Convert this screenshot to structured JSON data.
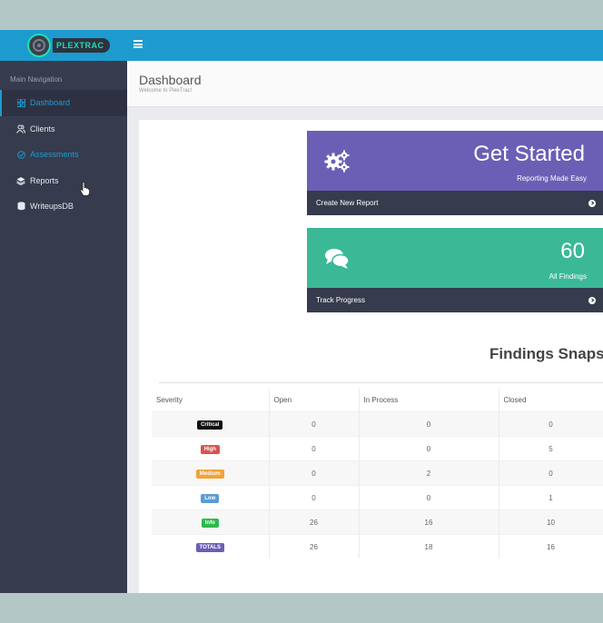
{
  "app": {
    "logo_text": "PLEXTRAC"
  },
  "sidebar": {
    "title": "Main Navigation",
    "items": [
      {
        "label": "Dashboard",
        "icon": "grid-icon"
      },
      {
        "label": "Clients",
        "icon": "users-icon"
      },
      {
        "label": "Assessments",
        "icon": "check-circle-icon"
      },
      {
        "label": "Reports",
        "icon": "layers-icon"
      },
      {
        "label": "WriteupsDB",
        "icon": "database-icon"
      }
    ]
  },
  "header": {
    "title": "Dashboard",
    "subtitle": "Welcome to PlexTrac!"
  },
  "cards": {
    "get_started": {
      "title": "Get Started",
      "subtitle": "Reporting Made Easy",
      "action": "Create New Report",
      "color": "#6b5fb5"
    },
    "findings": {
      "count": "60",
      "subtitle": "All Findings",
      "action": "Track Progress",
      "color": "#3bb996"
    }
  },
  "snapshot": {
    "title": "Findings Snapsh",
    "columns": [
      "Severity",
      "Open",
      "In Process",
      "Closed"
    ],
    "rows": [
      {
        "severity": "Critical",
        "color": "#111111",
        "open": "0",
        "in_process": "0",
        "closed": "0"
      },
      {
        "severity": "High",
        "color": "#d9534f",
        "open": "0",
        "in_process": "0",
        "closed": "5"
      },
      {
        "severity": "Medium",
        "color": "#f0a33a",
        "open": "0",
        "in_process": "2",
        "closed": "0"
      },
      {
        "severity": "Low",
        "color": "#5b9bd5",
        "open": "0",
        "in_process": "0",
        "closed": "1"
      },
      {
        "severity": "Info",
        "color": "#2db84d",
        "open": "26",
        "in_process": "16",
        "closed": "10"
      },
      {
        "severity": "TOTALS",
        "color": "#6b5fb5",
        "open": "26",
        "in_process": "18",
        "closed": "16"
      }
    ]
  }
}
